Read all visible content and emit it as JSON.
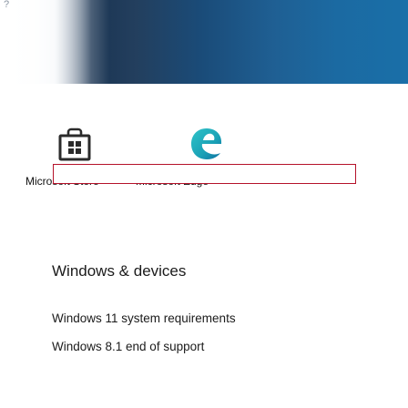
{
  "banner": {
    "corner_glyph": "?"
  },
  "apps": [
    {
      "label": "Microsoft Store",
      "icon": "store-bag-icon"
    },
    {
      "label": "Microsoft Edge",
      "icon": "edge-icon"
    }
  ],
  "focus_box": {
    "value": ""
  },
  "section": {
    "title": "Windows & devices",
    "links": [
      {
        "label": "Windows 11 system requirements"
      },
      {
        "label": "Windows 8.1 end of support"
      }
    ]
  },
  "colors": {
    "banner_dark": "#1b3553",
    "banner_blue": "#1a6fa8",
    "focus_border": "#b5122a",
    "edge_teal": "#1aa1b6",
    "store_dark": "#2b2b2b"
  }
}
